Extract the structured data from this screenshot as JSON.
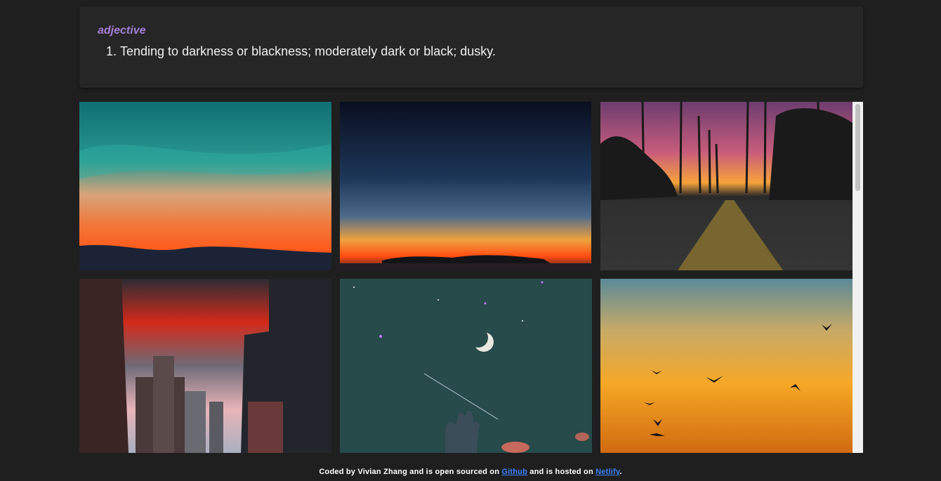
{
  "definition": {
    "part_of_speech": "adjective",
    "entries": [
      "Tending to darkness or blackness; moderately dark or black; dusky."
    ]
  },
  "gallery": {
    "photos": [
      {
        "name": "teal-orange-sunset-photo"
      },
      {
        "name": "night-sky-horizon-photo"
      },
      {
        "name": "palm-road-sunset-photo"
      },
      {
        "name": "city-red-clouds-photo"
      },
      {
        "name": "moon-hand-photo"
      },
      {
        "name": "birds-golden-sky-photo"
      }
    ]
  },
  "footer": {
    "prefix": "Coded by Vivian Zhang and is open sourced on ",
    "github_label": "Github",
    "middle": " and is hosted on ",
    "netlify_label": "Netlify",
    "suffix": "."
  },
  "colors": {
    "background": "#1f1f1f",
    "card": "#262626",
    "accent": "#a57fd6",
    "link": "#3b82f6"
  }
}
